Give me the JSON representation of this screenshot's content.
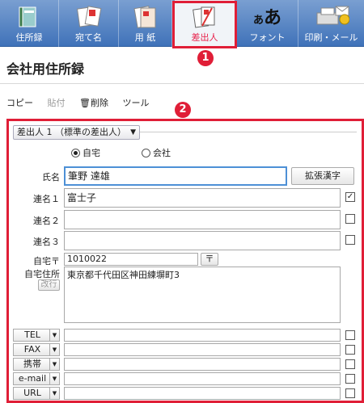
{
  "tabs": [
    {
      "label": "住所録"
    },
    {
      "label": "宛て名"
    },
    {
      "label": "用 紙"
    },
    {
      "label": "差出人"
    },
    {
      "label": "フォント"
    },
    {
      "label": "印刷・メール"
    }
  ],
  "badges": {
    "one": "1",
    "two": "2"
  },
  "title": "会社用住所録",
  "toolbar": {
    "copy": "コピー",
    "paste": "貼付",
    "delete": "削除",
    "tool": "ツール"
  },
  "sender_select": "差出人 1 （標準の差出人）",
  "radio": {
    "home": "自宅",
    "company": "会社"
  },
  "fields": {
    "name_label": "氏名",
    "name_value": "筆野 達雄",
    "kanji_button": "拡張漢字",
    "ren1_label": "連名１",
    "ren1_value": "富士子",
    "ren2_label": "連名２",
    "ren3_label": "連名３",
    "postal_label": "自宅〒",
    "postal_value": "1010022",
    "postal_button": "〒",
    "address_label": "自宅住所",
    "address_value": "東京都千代田区神田練塀町3",
    "kaigyo_button": "改行"
  },
  "contacts": [
    {
      "label": "TEL"
    },
    {
      "label": "FAX"
    },
    {
      "label": "携帯"
    },
    {
      "label": "e-mail"
    },
    {
      "label": "URL"
    }
  ],
  "colors": {
    "accent_red": "#e01e37",
    "tab_blue": "#3f72b9"
  }
}
